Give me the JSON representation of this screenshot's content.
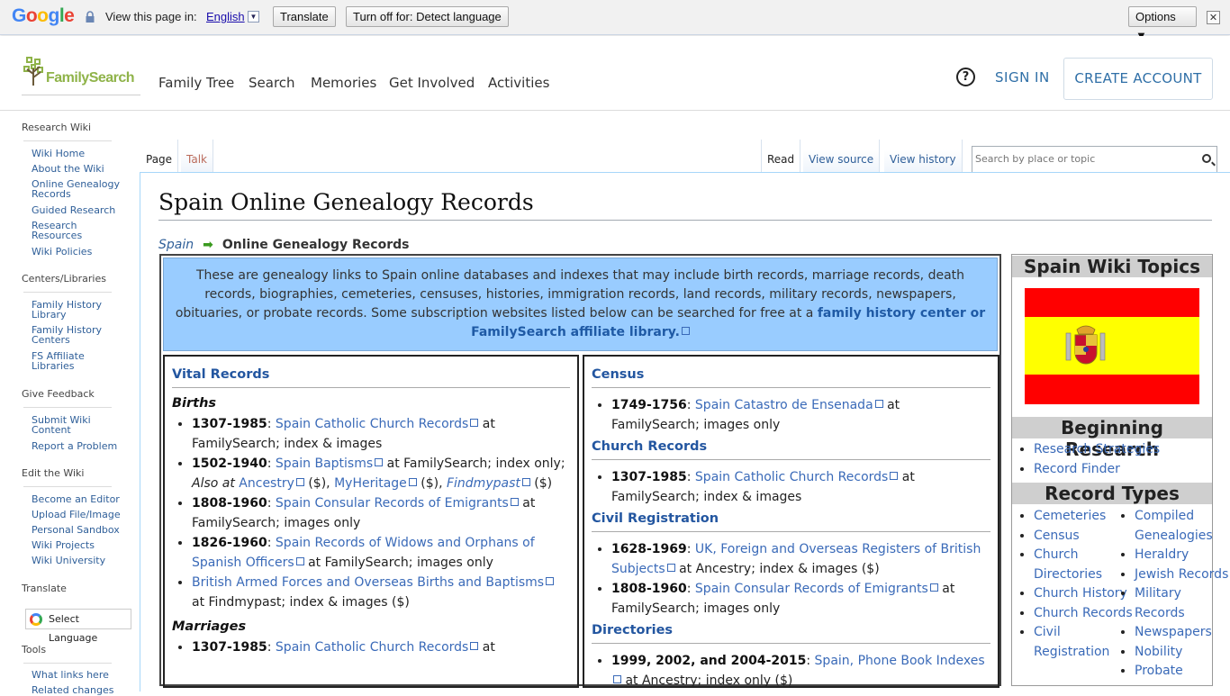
{
  "translate_bar": {
    "brand": "Google",
    "view_label": "View this page in:",
    "language": "English",
    "translate_btn": "Translate",
    "turnoff_btn": "Turn off for: Detect language",
    "options_btn": "Options ▼",
    "close": "✕"
  },
  "header": {
    "logo_text": "FamilySearch",
    "nav": [
      "Family Tree",
      "Search",
      "Memories",
      "Get Involved",
      "Activities"
    ],
    "help": "?",
    "sign_in": "SIGN IN",
    "create_account": "CREATE ACCOUNT"
  },
  "sidebar": {
    "research_wiki": "Research Wiki",
    "research_items": [
      "Wiki Home",
      "About the Wiki",
      "Online Genealogy Records",
      "Guided Research",
      "Research Resources",
      "Wiki Policies"
    ],
    "centers": "Centers/Libraries",
    "centers_items": [
      "Family History Library",
      "Family History Centers",
      "FS Affiliate Libraries"
    ],
    "feedback": "Give Feedback",
    "feedback_items": [
      "Submit Wiki Content",
      "Report a Problem"
    ],
    "edit": "Edit the Wiki",
    "edit_items": [
      "Become an Editor",
      "Upload File/Image",
      "Personal Sandbox",
      "Wiki Projects",
      "Wiki University"
    ],
    "translate": "Translate",
    "select_language": "Select Language",
    "tools": "Tools",
    "tools_items": [
      "What links here",
      "Related changes"
    ]
  },
  "tabs": {
    "page": "Page",
    "talk": "Talk",
    "read": "Read",
    "view_source": "View source",
    "view_history": "View history"
  },
  "search": {
    "placeholder": "Search by place or topic"
  },
  "page": {
    "title": "Spain Online Genealogy Records",
    "crumb_parent": "Spain",
    "crumb_arrow": "➡",
    "crumb_current": "Online Genealogy Records",
    "intro": "These are genealogy links to Spain online databases and indexes that may include birth records, marriage records, death records, biographies, cemeteries, censuses, histories, immigration records, land records, military records, newspapers, obituaries, or probate records. Some subscription websites listed below can be searched for free at a ",
    "intro_link": "family history center or FamilySearch affiliate library."
  },
  "left_col": {
    "vital": "Vital Records",
    "births": "Births",
    "marriages": "Marriages",
    "births_items": [
      {
        "years": "1307-1985",
        "link": "Spain Catholic Church Records",
        "rest": " at FamilySearch; index & images"
      },
      {
        "years": "1502-1940",
        "link": "Spain Baptisms",
        "rest": " at FamilySearch; index only; ",
        "also": "Also at ",
        "l2": "Ancestry",
        "r2": " ($), ",
        "l3": "MyHeritage",
        "r3": " ($), ",
        "l4": "Findmypast",
        "r4": " ($)"
      },
      {
        "years": "1808-1960",
        "link": "Spain Consular Records of Emigrants",
        "rest": " at FamilySearch; images only"
      },
      {
        "years": "1826-1960",
        "link": "Spain Records of Widows and Orphans of Spanish Officers",
        "rest": " at FamilySearch; images only"
      },
      {
        "years": "",
        "link": "British Armed Forces and Overseas Births and Baptisms",
        "rest": " at Findmypast; index & images ($)"
      }
    ],
    "marriages_items": [
      {
        "years": "1307-1985",
        "link": "Spain Catholic Church Records",
        "rest": " at"
      }
    ]
  },
  "right_col": {
    "census": "Census",
    "church": "Church Records",
    "civil": "Civil Registration",
    "directories": "Directories",
    "census_items": [
      {
        "years": "1749-1756",
        "link": "Spain Catastro de Ensenada",
        "rest": " at FamilySearch; images only"
      }
    ],
    "church_items": [
      {
        "years": "1307-1985",
        "link": "Spain Catholic Church Records",
        "rest": " at FamilySearch; index & images"
      }
    ],
    "civil_items": [
      {
        "years": "1628-1969",
        "link": "UK, Foreign and Overseas Registers of British Subjects",
        "rest": " at Ancestry; index & images ($)"
      },
      {
        "years": "1808-1960",
        "link": "Spain Consular Records of Emigrants",
        "rest": " at FamilySearch; images only"
      }
    ],
    "directories_items": [
      {
        "years": "1999, 2002, and 2004-2015",
        "link": "Spain, Phone Book Indexes",
        "rest": " at Ancestry; index only ($)"
      }
    ]
  },
  "topics": {
    "title": "Spain Wiki Topics",
    "beginning": "Beginning Research",
    "beginning_items": [
      "Research Strategies",
      "Record Finder"
    ],
    "record_types": "Record Types",
    "col1": [
      "Cemeteries",
      "Census",
      "Church Directories",
      "Church History",
      "Church Records",
      "Civil Registration"
    ],
    "col2": [
      "Compiled Genealogies",
      "Heraldry",
      "Jewish Records",
      "Military Records",
      "Newspapers",
      "Nobility",
      "Probate"
    ]
  },
  "colors": {
    "link": "#2f5f99",
    "intro_bg": "#99ccff",
    "flag_red": "#ff0000",
    "flag_yellow": "#ffff00"
  }
}
